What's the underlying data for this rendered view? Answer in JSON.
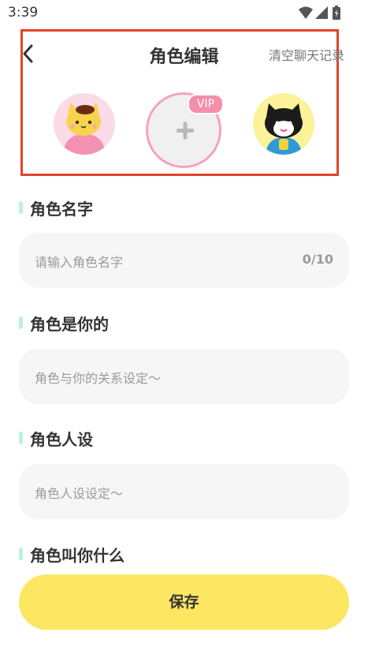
{
  "status_bar": {
    "time": "3:39",
    "icons": [
      "wifi-icon",
      "signal-icon",
      "battery-icon"
    ]
  },
  "header": {
    "title": "角色编辑",
    "clear_chat_label": "清空聊天记录",
    "vip_badge": "VIP",
    "accent_border_color": "#e2432b"
  },
  "avatars": {
    "left": "cat-avatar-pink",
    "middle": "add-avatar",
    "right": "cat-avatar-black"
  },
  "sections": {
    "name": {
      "label": "角色名字",
      "placeholder": "请输入角色名字",
      "counter": "0/10"
    },
    "relation": {
      "label": "角色是你的",
      "placeholder": "角色与你的关系设定～"
    },
    "persona": {
      "label": "角色人设",
      "placeholder": "角色人设设定～"
    },
    "callname": {
      "label": "角色叫你什么"
    }
  },
  "actions": {
    "save_label": "保存",
    "save_color": "#fde661"
  }
}
